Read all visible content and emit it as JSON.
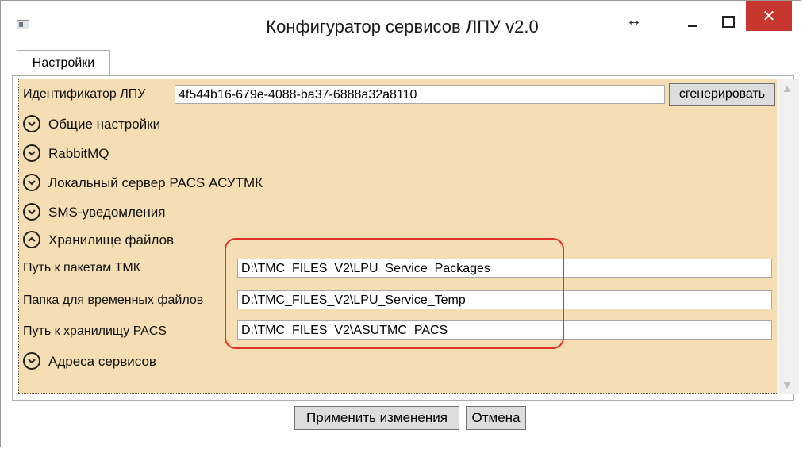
{
  "window": {
    "title": "Конфигуратор сервисов ЛПУ v2.0",
    "close_glyph": "✕",
    "resize_glyph": "↔"
  },
  "tabs": [
    {
      "label": "Настройки",
      "selected": true
    }
  ],
  "identifier": {
    "label": "Идентификатор ЛПУ",
    "value": "4f544b16-679e-4088-ba37-6888a32a8110",
    "generate_button": "сгенерировать"
  },
  "sections": [
    {
      "label": "Общие настройки",
      "expanded": false
    },
    {
      "label": "RabbitMQ",
      "expanded": false
    },
    {
      "label": "Локальный сервер PACS АСУТМК",
      "expanded": false
    },
    {
      "label": "SMS-уведомления",
      "expanded": false
    },
    {
      "label": "Хранилище файлов",
      "expanded": true
    },
    {
      "label": "Адреса сервисов",
      "expanded": false
    }
  ],
  "storage_fields": [
    {
      "label": "Путь к пакетам ТМК",
      "value": "D:\\TMC_FILES_V2\\LPU_Service_Packages"
    },
    {
      "label": "Папка для временных файлов",
      "value": "D:\\TMC_FILES_V2\\LPU_Service_Temp"
    },
    {
      "label": "Путь к хранилищу PACS",
      "value": "D:\\TMC_FILES_V2\\ASUTMC_PACS"
    }
  ],
  "footer": {
    "apply_button": "Применить изменения",
    "cancel_button": "Отмена"
  },
  "colors": {
    "panel_background": "#f5deb3",
    "highlight": "#e0302a",
    "close_button": "#c7372f"
  }
}
